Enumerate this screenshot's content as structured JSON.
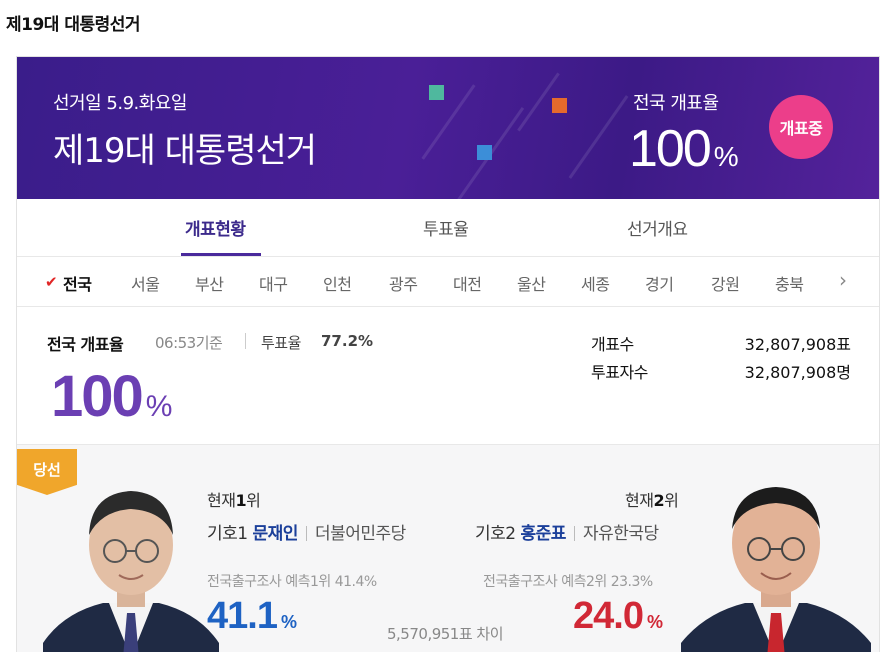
{
  "page_heading": "제19대 대통령선거",
  "banner": {
    "date": "선거일 5.9.화요일",
    "title": "제19대 대통령선거",
    "rate_label": "전국 개표율",
    "rate_value": "100",
    "rate_unit": "%",
    "status_badge": "개표중"
  },
  "tabs": [
    {
      "label": "개표현황",
      "active": true
    },
    {
      "label": "투표율",
      "active": false
    },
    {
      "label": "선거개요",
      "active": false
    }
  ],
  "regions": [
    "전국",
    "서울",
    "부산",
    "대구",
    "인천",
    "광주",
    "대전",
    "울산",
    "세종",
    "경기",
    "강원",
    "충북"
  ],
  "summary": {
    "label": "전국 개표율",
    "time": "06:53기준",
    "turnout_label": "투표율",
    "turnout_value": "77.2%",
    "count_rate": "100",
    "count_rate_unit": "%",
    "counted_label": "개표수",
    "counted_value": "32,807,908표",
    "voters_label": "투표자수",
    "voters_value": "32,807,908명"
  },
  "result": {
    "winner_badge": "당선",
    "left": {
      "rank_prefix": "현재",
      "rank_num": "1",
      "rank_suffix": "위",
      "number": "기호1",
      "name": "문재인",
      "party": "더불어민주당",
      "exit_poll": "전국출구조사 예측1위 41.4%",
      "percent": "41.1",
      "unit": "%"
    },
    "right": {
      "rank_prefix": "현재",
      "rank_num": "2",
      "rank_suffix": "위",
      "number": "기호2",
      "name": "홍준표",
      "party": "자유한국당",
      "exit_poll": "전국출구조사 예측2위 23.3%",
      "percent": "24.0",
      "unit": "%"
    },
    "gap": "5,570,951표 차이"
  },
  "colors": {
    "banner": "#3a1d8a",
    "badge_pink": "#ec3e8a",
    "winner_gold": "#f0a62b",
    "blue": "#1e62c3",
    "red": "#d12836",
    "purple": "#6b3fb3"
  }
}
